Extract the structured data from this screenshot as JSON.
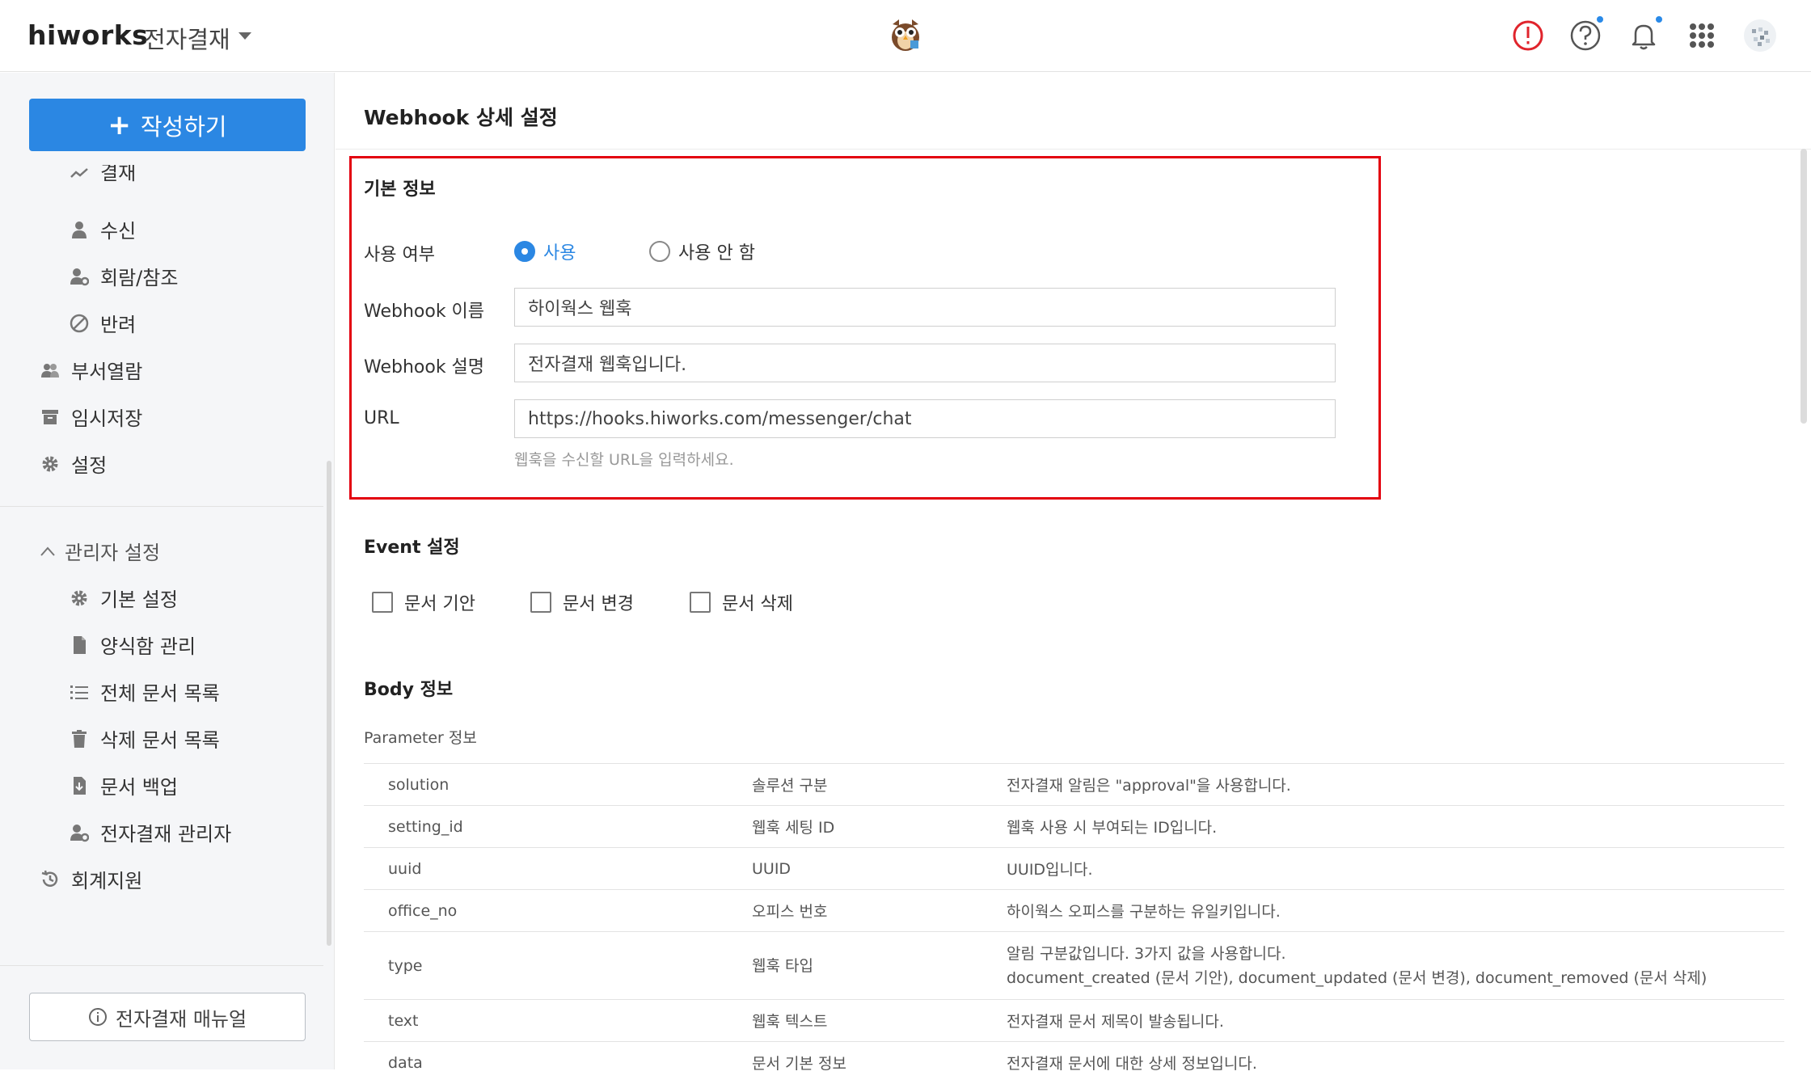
{
  "header": {
    "brand": "hiworks",
    "app_name": "전자결재"
  },
  "sidebar": {
    "compose_label": "작성하기",
    "compose_plus": "+",
    "items": [
      {
        "label": "결재",
        "icon": "trend-icon"
      },
      {
        "label": "수신",
        "icon": "person-icon"
      },
      {
        "label": "회람/참조",
        "icon": "person-gear-icon"
      },
      {
        "label": "반려",
        "icon": "block-icon"
      },
      {
        "label": "부서열람",
        "icon": "group-icon"
      },
      {
        "label": "임시저장",
        "icon": "archive-icon"
      },
      {
        "label": "설정",
        "icon": "gear-icon"
      }
    ],
    "admin_header": "관리자 설정",
    "admin_items": [
      {
        "label": "기본 설정",
        "icon": "gear-icon"
      },
      {
        "label": "양식함 관리",
        "icon": "document-icon"
      },
      {
        "label": "전체 문서 목록",
        "icon": "list-icon"
      },
      {
        "label": "삭제 문서 목록",
        "icon": "trash-icon"
      },
      {
        "label": "문서 백업",
        "icon": "download-doc-icon"
      },
      {
        "label": "전자결재 관리자",
        "icon": "person-gear-icon"
      }
    ],
    "accounting_label": "회계지원",
    "manual_label": "전자결재 매뉴얼"
  },
  "main": {
    "page_title": "Webhook 상세 설정",
    "basic_info": {
      "title": "기본 정보",
      "use_label": "사용 여부",
      "use_on": "사용",
      "use_off": "사용 안 함",
      "selected": "사용",
      "name_label": "Webhook 이름",
      "name_value": "하이웍스 웹훅",
      "desc_label": "Webhook 설명",
      "desc_value": "전자결재 웹훅입니다.",
      "url_label": "URL",
      "url_value": "https://hooks.hiworks.com/messenger/chat",
      "url_hint": "웹훅을 수신할 URL을 입력하세요."
    },
    "event": {
      "title": "Event 설정",
      "options": [
        "문서 기안",
        "문서 변경",
        "문서 삭제"
      ]
    },
    "body": {
      "title": "Body 정보",
      "param_label": "Parameter 정보",
      "rows": [
        {
          "key": "solution",
          "name": "솔루션 구분",
          "desc": "전자결재 알림은 \"approval\"을 사용합니다."
        },
        {
          "key": "setting_id",
          "name": "웹훅 세팅 ID",
          "desc": "웹훅 사용 시 부여되는 ID입니다."
        },
        {
          "key": "uuid",
          "name": "UUID",
          "desc": "UUID입니다."
        },
        {
          "key": "office_no",
          "name": "오피스 번호",
          "desc": "하이웍스 오피스를 구분하는 유일키입니다."
        },
        {
          "key": "type",
          "name": "웹훅 타입",
          "desc": "알림 구분값입니다. 3가지 값을 사용합니다.",
          "desc2": "document_created (문서 기안), document_updated (문서 변경), document_removed (문서 삭제)"
        },
        {
          "key": "text",
          "name": "웹훅 텍스트",
          "desc": "전자결재 문서 제목이 발송됩니다."
        },
        {
          "key": "data",
          "name": "문서 기본 정보",
          "desc": "전자결재 문서에 대한 상세 정보입니다."
        }
      ]
    }
  },
  "colors": {
    "accent": "#2b87e3",
    "highlight_border": "#e3000f",
    "alert_red": "#e0242c"
  }
}
